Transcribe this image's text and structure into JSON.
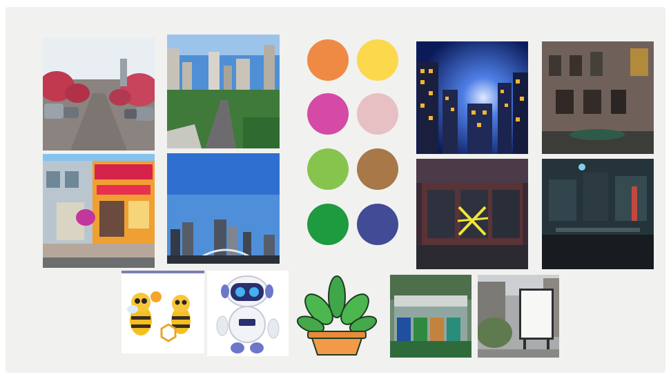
{
  "moodboard": {
    "palette": [
      {
        "name": "orange-swatch",
        "color": "#ef8a45"
      },
      {
        "name": "yellow-swatch",
        "color": "#fbd84c"
      },
      {
        "name": "magenta-swatch",
        "color": "#d44aa5"
      },
      {
        "name": "pale-pink-swatch",
        "color": "#e7c0c3"
      },
      {
        "name": "light-green-swatch",
        "color": "#86c44e"
      },
      {
        "name": "brown-swatch",
        "color": "#a87848"
      },
      {
        "name": "green-swatch",
        "color": "#1e9a3f"
      },
      {
        "name": "indigo-swatch",
        "color": "#414b96"
      }
    ],
    "photos": [
      {
        "name": "photo-tree-lined-street"
      },
      {
        "name": "photo-city-highway-aerial"
      },
      {
        "name": "photo-cartoon-storefronts"
      },
      {
        "name": "photo-city-skyline-blue-sky"
      },
      {
        "name": "photo-night-city-buildings"
      },
      {
        "name": "photo-abandoned-building"
      },
      {
        "name": "photo-boarded-storefront-caution-tape"
      },
      {
        "name": "photo-dark-alley-street"
      },
      {
        "name": "illustration-cartoon-bees"
      },
      {
        "name": "illustration-robot"
      },
      {
        "name": "illustration-potted-plant"
      },
      {
        "name": "photo-recycling-bins"
      },
      {
        "name": "photo-blank-billboard-street"
      }
    ]
  }
}
